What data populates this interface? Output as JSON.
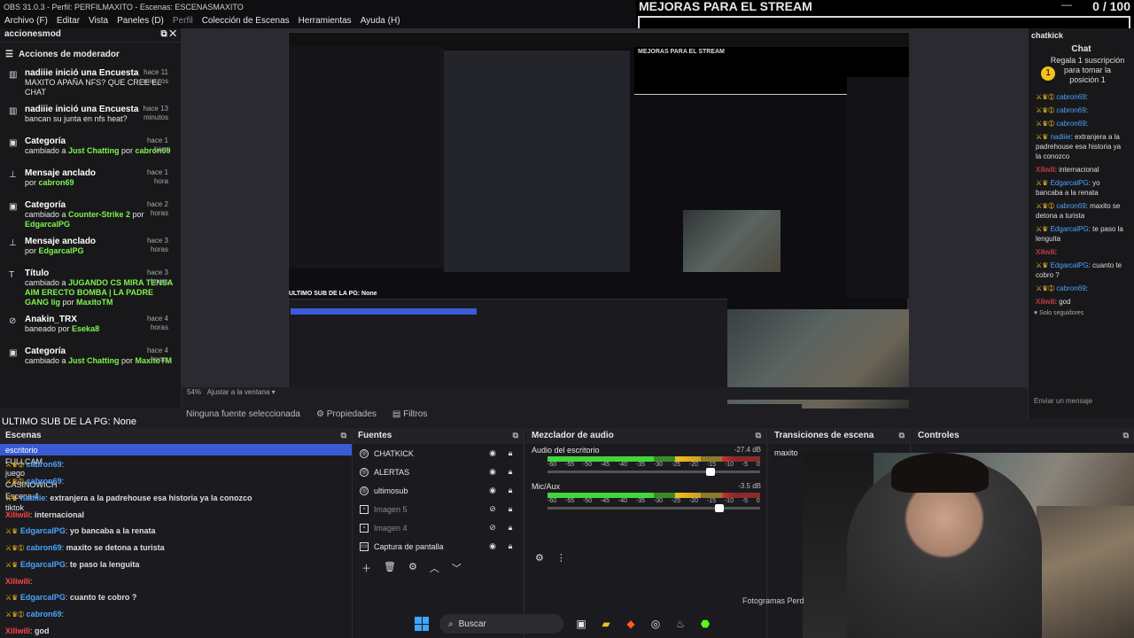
{
  "window": {
    "title": "OBS 31.0.3 - Perfil: PERFILMAXITO - Escenas: ESCENASMAXITO"
  },
  "menu": [
    "Archivo (F)",
    "Editar",
    "Vista",
    "Paneles (D)",
    "Perfil",
    "Colección de Escenas",
    "Herramientas",
    "Ayuda (H)"
  ],
  "goal": {
    "title": "MEJORAS PARA EL STREAM",
    "count": "0 / 100",
    "progress": 0
  },
  "mod": {
    "dock_title": "accionesmod",
    "header": "Acciones de moderador",
    "items": [
      {
        "user": "nadiiie",
        "action": " inició una Encuesta",
        "detail": "MAXITO APAÑA NFS? QUE CREE EL CHAT",
        "time": "hace 11 minutos"
      },
      {
        "user": "nadiiie",
        "action": " inició una Encuesta",
        "detail": "bancan su junta en nfs heat?",
        "time": "hace 13 minutos"
      },
      {
        "user": "Categoría",
        "action": "",
        "detail_prefix": "cambiado a ",
        "highlight": "Just Chatting",
        "detail_mid": " por ",
        "by": "cabron69",
        "time": "hace 1 hora"
      },
      {
        "user": "Mensaje anclado",
        "action": "",
        "detail_prefix": "por ",
        "highlight": "",
        "detail_mid": "",
        "by": "cabron69",
        "time": "hace 1 hora"
      },
      {
        "user": "Categoría",
        "action": "",
        "detail_prefix": "cambiado a ",
        "highlight": "Counter-Strike 2",
        "detail_mid": " por ",
        "by": "EdgarcalPG",
        "time": "hace 2 horas"
      },
      {
        "user": "Mensaje anclado",
        "action": "",
        "detail_prefix": "por ",
        "highlight": "",
        "detail_mid": "",
        "by": "EdgarcalPG",
        "time": "hace 3 horas"
      },
      {
        "user": "Título",
        "action": "",
        "detail_prefix": "cambiado a ",
        "highlight": "JUGANDO CS MIRA TENSA AIM ERECTO BOMBA | LA PADRE GANG lig",
        "detail_mid": " por ",
        "by": "MaxitoTM",
        "time": "hace 3 horas"
      },
      {
        "user": "Anakin_TRX",
        "action": "",
        "detail_prefix": "baneado por ",
        "highlight": "",
        "detail_mid": "",
        "by": "Eseka8",
        "time": "hace 4 horas"
      },
      {
        "user": "Categoría",
        "action": "",
        "detail_prefix": "cambiado a ",
        "highlight": "Just Chatting",
        "detail_mid": " por ",
        "by": "MaxitoTM",
        "time": "hace 4 horas"
      }
    ]
  },
  "preview": {
    "zoom_label": "54%",
    "fit_label": "Ajustar a la ventana",
    "nested_title": "ULTIMO SUB DE LA PG: None",
    "nested_goal": "MEJORAS PARA EL STREAM"
  },
  "toolbar": {
    "no_source": "Ninguna fuente seleccionada",
    "properties": "Propiedades",
    "filters": "Filtros"
  },
  "last_sub": "ULTIMO SUB DE LA PG: None",
  "chat": {
    "dock_title": "chatkick",
    "title": "Chat",
    "sub_promo": "Regala 1 suscripción para tomar la posición 1",
    "messages": [
      {
        "user": "cabron69",
        "text": ""
      },
      {
        "user": "cabron69",
        "text": ""
      },
      {
        "user": "cabron69",
        "text": ""
      },
      {
        "user": "nadiiie",
        "text": "extranjera a la padrehouse esa historia ya la conozco"
      },
      {
        "user": "Xiliwili",
        "text": "internacional"
      },
      {
        "user": "EdgarcalPG",
        "text": "yo bancaba a la renata"
      },
      {
        "user": "cabron69",
        "text": "maxito se detona a turista"
      },
      {
        "user": "EdgarcalPG",
        "text": "te paso la lenguita"
      },
      {
        "user": "Xiliwili",
        "text": ""
      },
      {
        "user": "EdgarcalPG",
        "text": "cuanto te cobro ?"
      },
      {
        "user": "cabron69",
        "text": ""
      },
      {
        "user": "Xiliwili",
        "text": "god"
      }
    ],
    "followers_only": "Solo seguidores",
    "send_placeholder": "Enviar un mensaje"
  },
  "scenes": {
    "title": "Escenas",
    "rows": [
      "escritorio",
      "FULLCAM",
      "juego",
      "CASINOWICH",
      "Escena 4",
      "tiktok"
    ]
  },
  "bottom_chat": [
    {
      "user": "cabron69",
      "text": ""
    },
    {
      "user": "cabron69",
      "text": ""
    },
    {
      "user": "nadiiie",
      "text": "extranjera a la padrehouse esa historia ya la conozco"
    },
    {
      "user": "Xiliwili",
      "text": "internacional"
    },
    {
      "user": "EdgarcalPG",
      "text": "yo bancaba a la renata"
    },
    {
      "user": "cabron69",
      "text": "maxito se detona a turista"
    },
    {
      "user": "EdgarcalPG",
      "text": "te paso la lenguita"
    },
    {
      "user": "Xiliwili",
      "text": ""
    },
    {
      "user": "EdgarcalPG",
      "text": "cuanto te cobro ?"
    },
    {
      "user": "cabron69",
      "text": ""
    },
    {
      "user": "Xiliwili",
      "text": "god"
    }
  ],
  "sources": {
    "title": "Fuentes",
    "items": [
      {
        "name": "CHATKICK",
        "visible": true
      },
      {
        "name": "ALERTAS",
        "visible": true
      },
      {
        "name": "ultimosub",
        "visible": true
      },
      {
        "name": "Imagen 5",
        "visible": false
      },
      {
        "name": "Imagen 4",
        "visible": false
      },
      {
        "name": "Captura de pantalla",
        "visible": true
      }
    ]
  },
  "mixer": {
    "title": "Mezclador de audio",
    "channels": [
      {
        "name": "Audio del escritorio",
        "db": "-27.4 dB",
        "level": 0.78
      },
      {
        "name": "Mic/Aux",
        "db": "-3.5 dB",
        "level": 0.82
      }
    ],
    "ticks": [
      "-60",
      "-55",
      "-50",
      "-45",
      "-40",
      "-35",
      "-30",
      "-25",
      "-20",
      "-15",
      "-10",
      "-5",
      "0"
    ]
  },
  "transitions": {
    "title": "Transiciones de escena",
    "current": "maxito"
  },
  "controls": {
    "title": "Controles"
  },
  "status": {
    "fotogramas": "Fotogramas Perd"
  },
  "taskbar": {
    "search": "Buscar"
  },
  "colors": {
    "accent": "#3a5bd6",
    "kick_green": "#53fc18",
    "chat_blue": "#4aa3ff",
    "chat_red": "#ff4545"
  }
}
